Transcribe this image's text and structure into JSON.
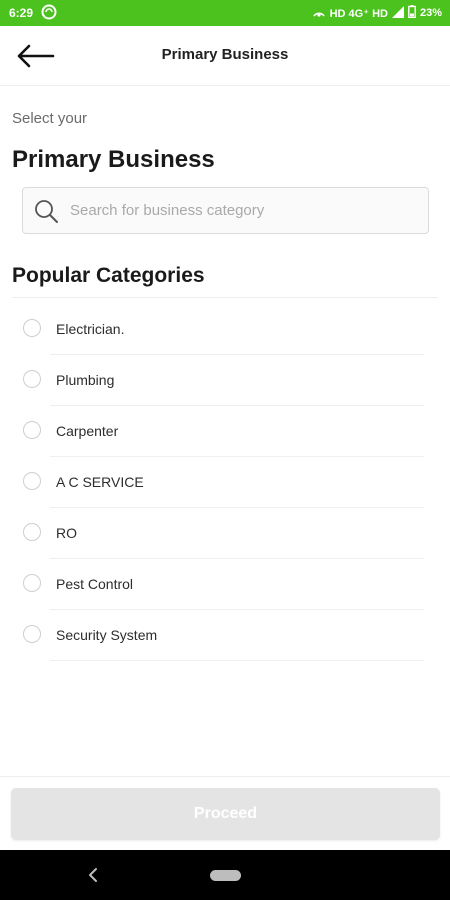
{
  "status_bar": {
    "time": "6:29",
    "network_text": "HD 4G⁺ HD",
    "battery_text": "23%"
  },
  "header": {
    "title": "Primary Business",
    "back_icon": "arrow-left-icon"
  },
  "intro": {
    "subtitle": "Select your",
    "heading": "Primary Business"
  },
  "search": {
    "icon": "search-icon",
    "placeholder": "Search for business category",
    "value": ""
  },
  "popular": {
    "title": "Popular Categories",
    "items": [
      {
        "label": "Electrician."
      },
      {
        "label": "Plumbing"
      },
      {
        "label": "Carpenter"
      },
      {
        "label": "A C SERVICE"
      },
      {
        "label": "RO"
      },
      {
        "label": "Pest Control"
      },
      {
        "label": "Security System"
      }
    ]
  },
  "footer": {
    "proceed_label": "Proceed"
  },
  "colors": {
    "status_bar": "#4cc21e",
    "proceed_disabled": "#e4e4e4"
  }
}
